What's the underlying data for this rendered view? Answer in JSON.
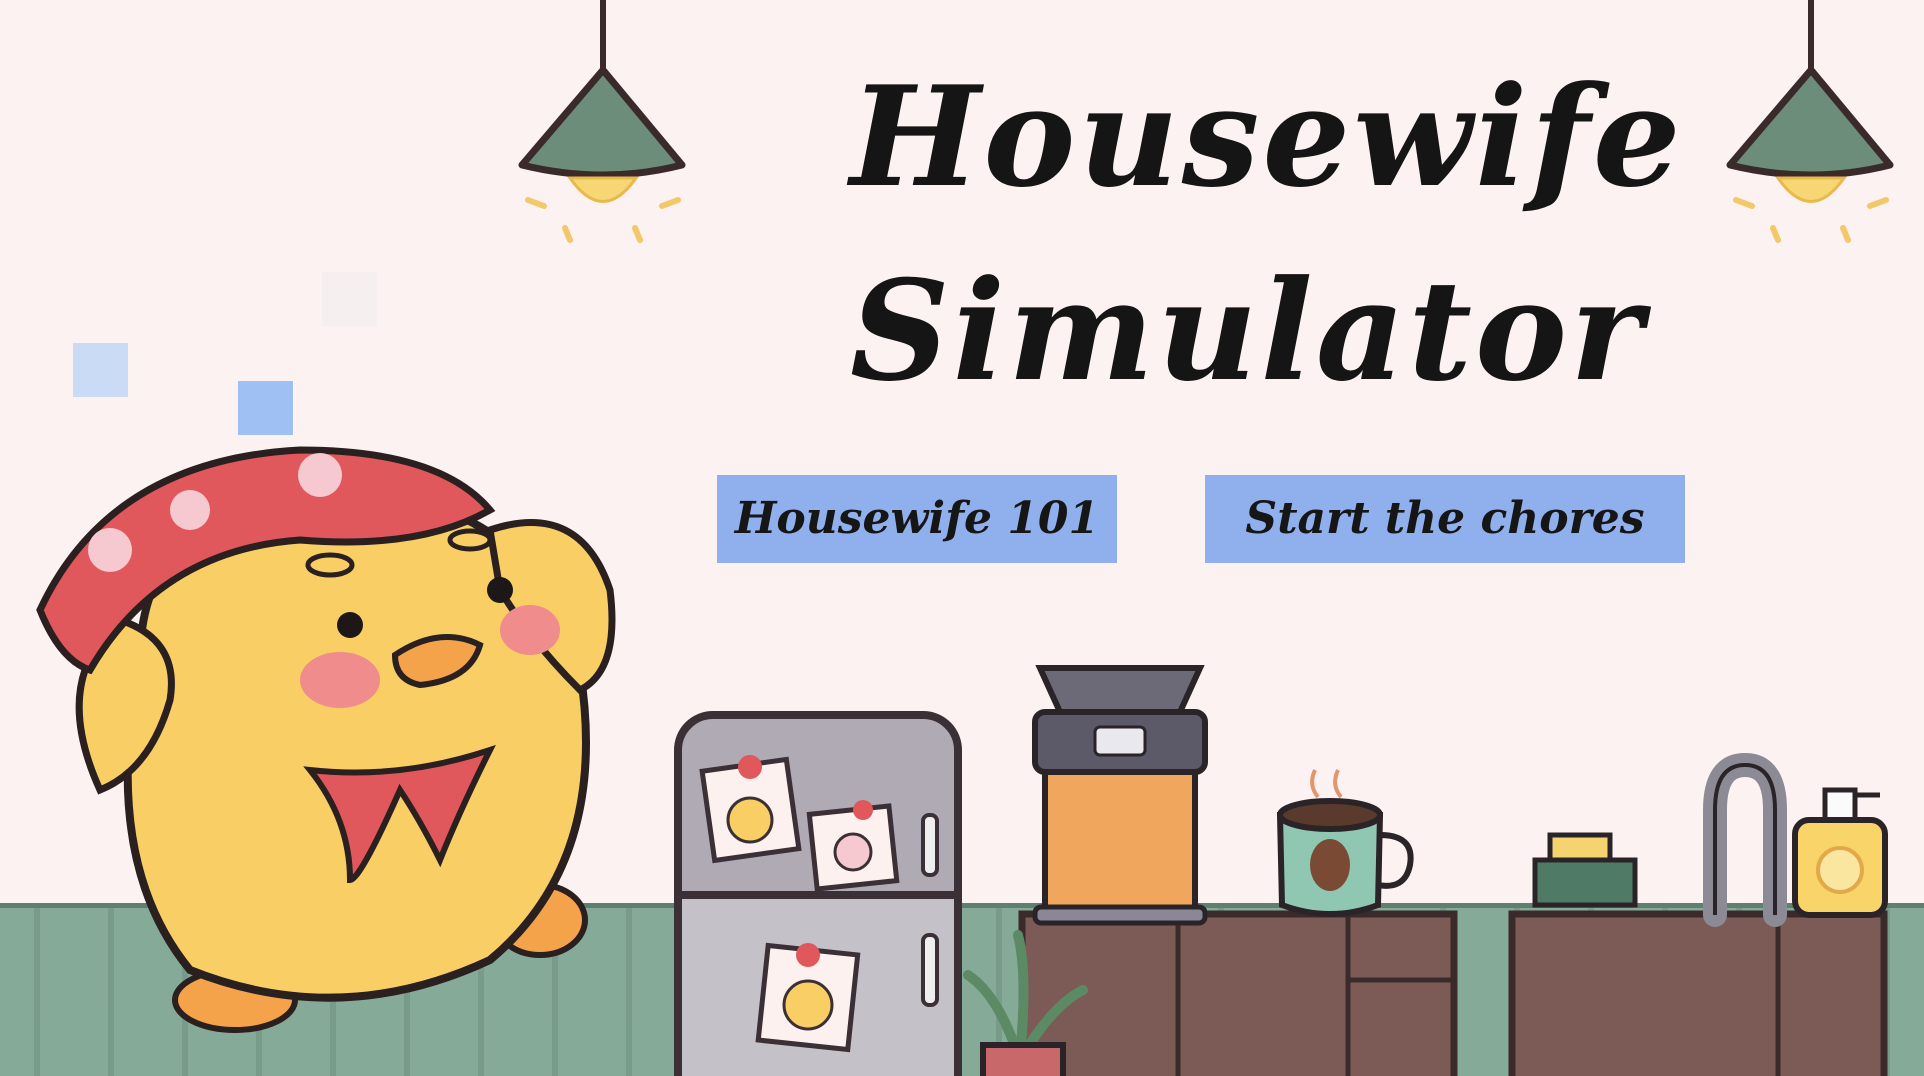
{
  "title": {
    "line1": "Housewife",
    "line2": "Simulator"
  },
  "menu": {
    "tutorial_label": "Housewife 101",
    "start_label": "Start the chores"
  },
  "colors": {
    "wall": "#fcf2f2",
    "floor": "#86aa98",
    "button": "#8fb0ec",
    "lamp_shade": "#6d8d7b",
    "lamp_bulb": "#f7d774",
    "duck_body": "#f9cf65",
    "bandana": "#e0575c",
    "cabinet": "#7c5a55"
  },
  "icons": [
    "lamp-icon",
    "duck-character",
    "fridge-icon",
    "coffee-machine-icon",
    "coffee-mug-icon",
    "sink-faucet-icon",
    "soap-bottle-icon",
    "sponge-icon",
    "plant-icon"
  ]
}
